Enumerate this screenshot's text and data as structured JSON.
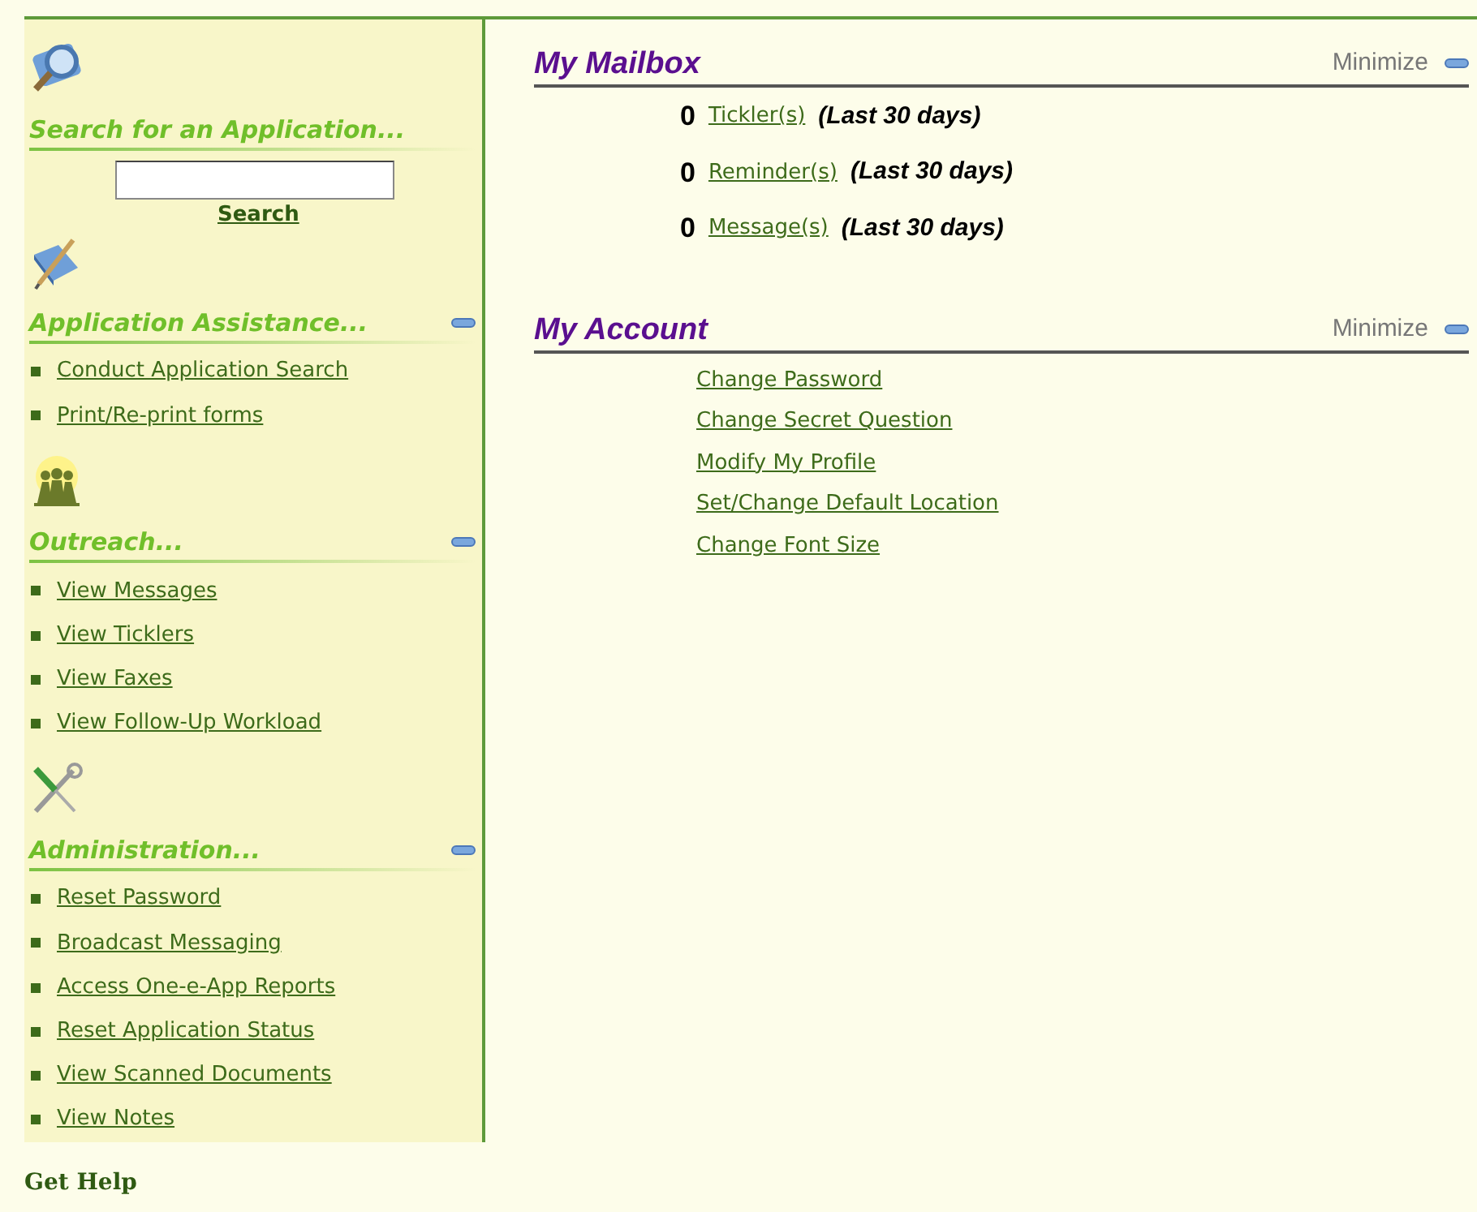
{
  "sidebar": {
    "search": {
      "heading": "Search for an Application...",
      "button": "Search"
    },
    "sections": [
      {
        "kind": "assist",
        "heading": "Application Assistance...",
        "expanded": true,
        "links": [
          "Conduct Application Search",
          "Print/Re-print forms"
        ]
      },
      {
        "kind": "outreach",
        "heading": "Outreach...",
        "expanded": true,
        "links": [
          "View Messages",
          "View Ticklers",
          "View Faxes",
          "View Follow-Up Workload"
        ]
      },
      {
        "kind": "admin",
        "heading": "Administration...",
        "expanded": true,
        "links": [
          "Reset Password",
          "Broadcast Messaging",
          "Access One-e-App Reports",
          "Reset Application Status",
          "View Scanned Documents",
          "View Notes"
        ]
      }
    ]
  },
  "main": {
    "panels": [
      {
        "kind": "mailbox",
        "title": "My Mailbox",
        "toggle": "Minimize",
        "expanded": true,
        "rows": [
          {
            "count": "0",
            "link": "Tickler(s)",
            "note": "(Last 30 days)"
          },
          {
            "count": "0",
            "link": "Reminder(s)",
            "note": "(Last 30 days)"
          },
          {
            "count": "0",
            "link": "Message(s)",
            "note": "(Last 30 days)"
          }
        ]
      },
      {
        "kind": "links",
        "title": "My Account",
        "toggle": "Minimize",
        "expanded": true,
        "links": [
          "Change Password",
          "Change Secret Question",
          "Modify My Profile",
          "Set/Change Default Location",
          "Change Font Size"
        ]
      }
    ]
  },
  "footer": {
    "help": "Get Help"
  }
}
